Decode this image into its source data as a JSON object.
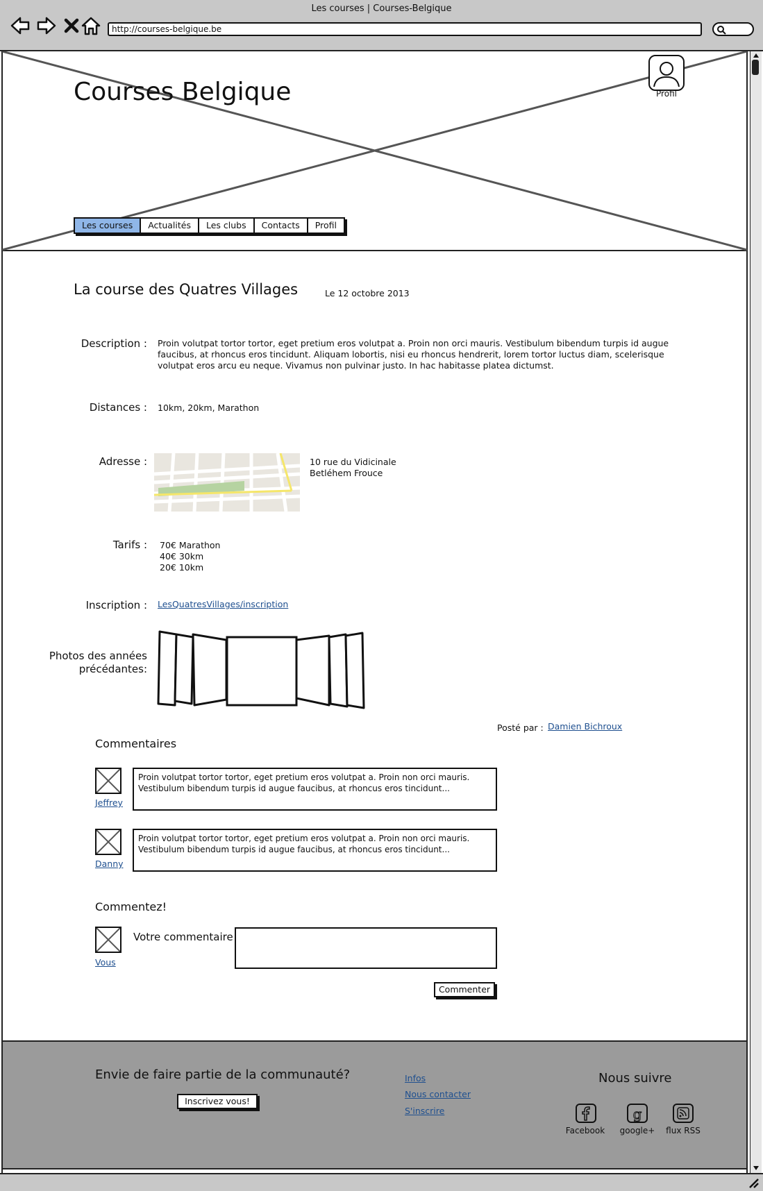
{
  "browser": {
    "window_title": "Les courses | Courses-Belgique",
    "url": "http://courses-belgique.be"
  },
  "header": {
    "site_title": "Courses Belgique",
    "profile_label": "Profil",
    "tabs": [
      {
        "label": "Les courses",
        "active": true
      },
      {
        "label": "Actualités",
        "active": false
      },
      {
        "label": "Les clubs",
        "active": false
      },
      {
        "label": "Contacts",
        "active": false
      },
      {
        "label": "Profil",
        "active": false
      }
    ]
  },
  "race": {
    "title": "La course des Quatres Villages",
    "date": "Le 12 octobre 2013",
    "description_label": "Description :",
    "description": "Proin volutpat tortor tortor, eget pretium eros volutpat a. Proin non orci mauris. Vestibulum bibendum turpis id augue faucibus, at rhoncus eros tincidunt. Aliquam lobortis, nisi eu rhoncus hendrerit, lorem tortor luctus diam, scelerisque volutpat eros arcu eu neque. Vivamus non pulvinar justo. In hac habitasse platea dictumst.",
    "distances_label": "Distances :",
    "distances": "10km, 20km, Marathon",
    "address_label": "Adresse :",
    "address_line1": "10 rue du Vidicinale",
    "address_line2": "Betléhem Frouce",
    "tarifs_label": "Tarifs :",
    "tarifs": [
      "70€ Marathon",
      "40€ 30km",
      "20€ 10km"
    ],
    "inscription_label": "Inscription :",
    "inscription_link": "LesQuatresVillages/inscription",
    "photos_label_line1": "Photos des années",
    "photos_label_line2": "précédantes:",
    "posted_by_label": "Posté par :",
    "posted_by": "Damien Bichroux"
  },
  "comments": {
    "title": "Commentaires",
    "items": [
      {
        "author": "Jeffrey",
        "text": "Proin volutpat tortor tortor, eget pretium eros volutpat a. Proin non orci mauris. Vestibulum bibendum turpis id augue faucibus, at rhoncus eros tincidunt..."
      },
      {
        "author": "Danny",
        "text": "Proin volutpat tortor tortor, eget pretium eros volutpat a. Proin non orci mauris. Vestibulum bibendum turpis id augue faucibus, at rhoncus eros tincidunt..."
      }
    ]
  },
  "comment_form": {
    "title": "Commentez!",
    "user": "Vous",
    "field_label": "Votre commentaire :",
    "submit_label": "Commenter"
  },
  "footer": {
    "question": "Envie de faire partie de la communauté?",
    "signup_button": "Inscrivez vous!",
    "links": [
      "Infos",
      "Nous contacter",
      "S'inscrire"
    ],
    "follow_title": "Nous suivre",
    "social": [
      {
        "label": "Facebook",
        "icon": "facebook-icon"
      },
      {
        "label": "google+",
        "icon": "google-plus-icon"
      },
      {
        "label": "flux RSS",
        "icon": "rss-icon"
      }
    ]
  },
  "colors": {
    "active_tab": "#8fb6e8",
    "link": "#1e4f8f",
    "chrome": "#c8c8c8",
    "footer": "#9b9b9b"
  }
}
